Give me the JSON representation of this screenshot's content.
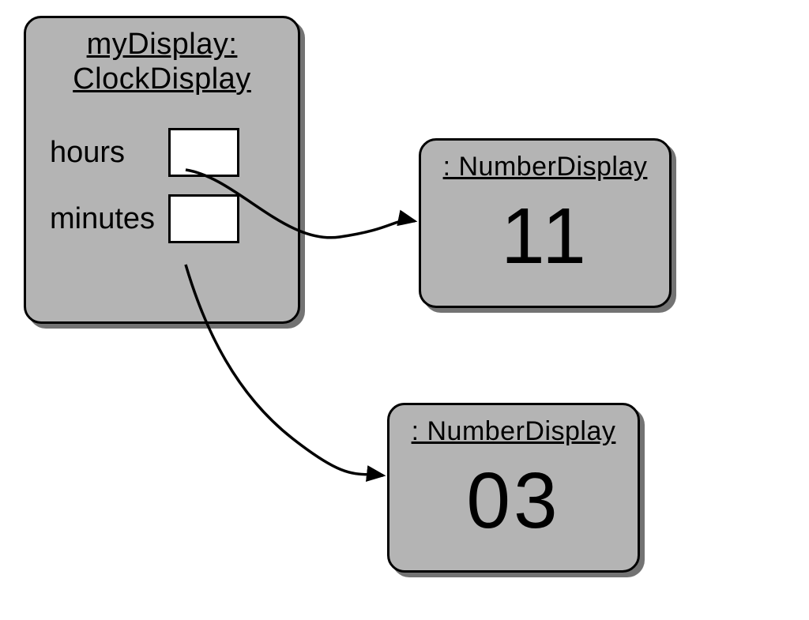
{
  "clockDisplay": {
    "title_line1": "myDisplay:",
    "title_line2": "ClockDisplay",
    "fields": {
      "hours_label": "hours",
      "minutes_label": "minutes"
    }
  },
  "numberDisplayHours": {
    "title": ": NumberDisplay",
    "value": "11"
  },
  "numberDisplayMinutes": {
    "title": ": NumberDisplay",
    "value": "03"
  }
}
